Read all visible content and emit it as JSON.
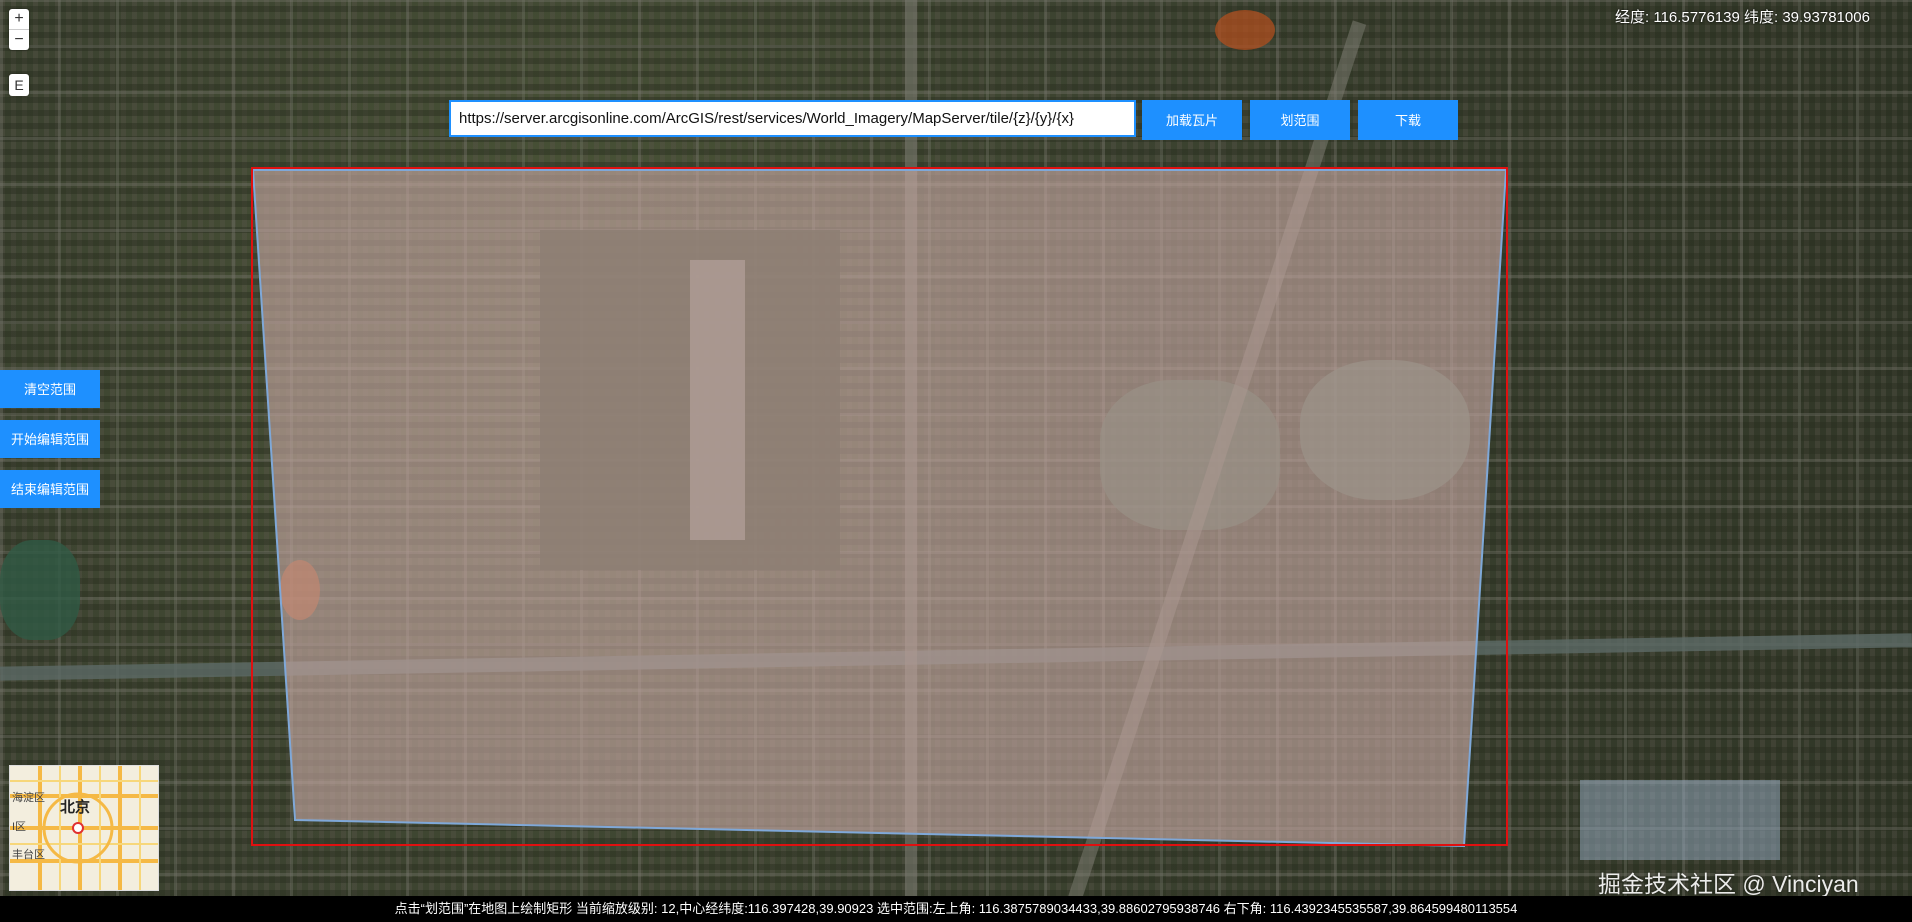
{
  "map": {
    "coord_readout": "经度: 116.5776139 纬度: 39.93781006",
    "overview_label": "北京",
    "overview_districts": [
      "海淀区",
      "I区",
      "丰台区"
    ]
  },
  "controls": {
    "zoom_in": "+",
    "zoom_out": "−",
    "extent_button": "E"
  },
  "toolbar": {
    "url_value": "https://server.arcgisonline.com/ArcGIS/rest/services/World_Imagery/MapServer/tile/{z}/{y}/{x}",
    "load_tiles": "加载瓦片",
    "draw_range": "划范围",
    "download": "下载"
  },
  "side": {
    "clear_range": "清空范围",
    "start_edit": "开始编辑范围",
    "end_edit": "结束编辑范围"
  },
  "watermark": "掘金技术社区 @ Vinciyan",
  "status": "点击“划范围”在地图上绘制矩形 当前缩放级别:   12,中心经纬度:116.397428,39.90923 选中范围:左上角: 116.3875789034433,39.88602795938746 右下角: 116.4392345535587,39.864599480113554",
  "colors": {
    "accent": "#1e90ff",
    "selection_border": "#e01010",
    "selection_fill": "#c8a9a4"
  }
}
